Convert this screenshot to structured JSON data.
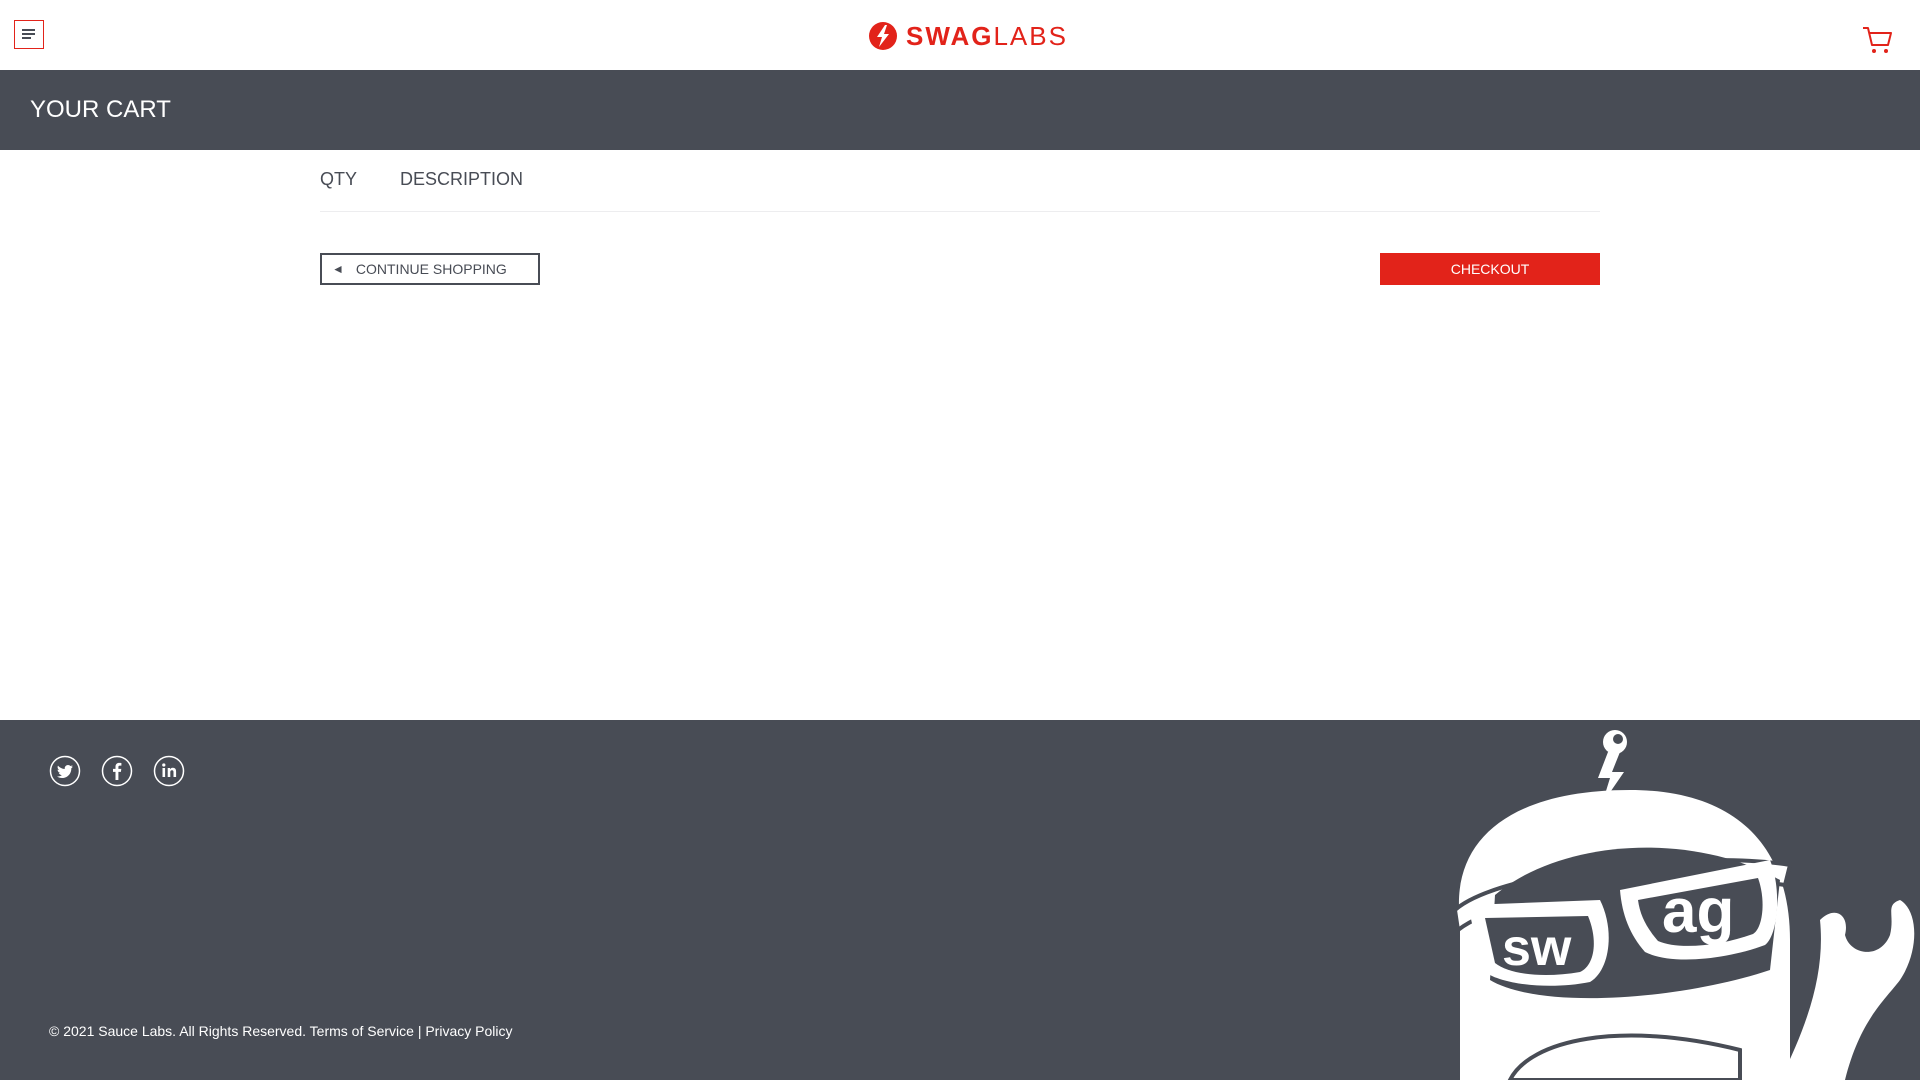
{
  "header": {
    "menu_label": "Open Menu",
    "logo_bold": "SWAG",
    "logo_thin": "LABS",
    "menu_icon": "hamburger-icon",
    "cart_icon": "shopping-cart-icon"
  },
  "page": {
    "title": "YOUR CART"
  },
  "cart": {
    "qty_label": "QTY",
    "description_label": "DESCRIPTION",
    "items": []
  },
  "actions": {
    "continue_arrow": "◄",
    "continue_label": "CONTINUE SHOPPING",
    "checkout_label": "CHECKOUT"
  },
  "footer": {
    "social": [
      "twitter-icon",
      "facebook-icon",
      "linkedin-icon"
    ],
    "copyright": "© 2021 Sauce Labs. All Rights Reserved.",
    "terms_label": "Terms of Service",
    "separator": "|",
    "privacy_label": "Privacy Policy"
  },
  "colors": {
    "accent": "#e2231a",
    "dark": "#484c55",
    "white": "#ffffff"
  }
}
